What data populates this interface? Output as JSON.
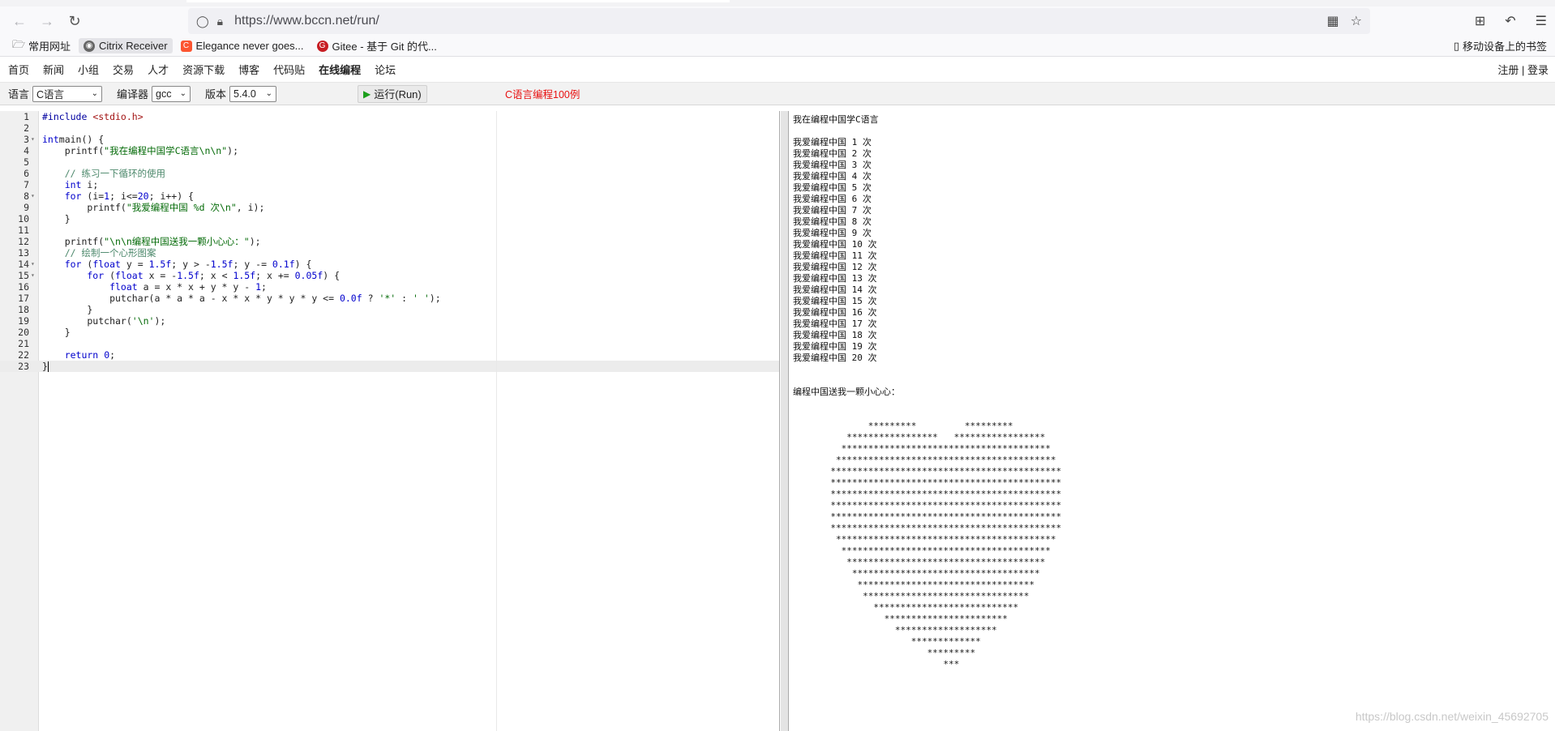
{
  "browser": {
    "url": "https://www.bccn.net/run/",
    "bookmarks": [
      {
        "label": "常用网址",
        "icon": "folder-icon"
      },
      {
        "label": "Citrix Receiver",
        "icon": "citrix-icon"
      },
      {
        "label": "Elegance never goes...",
        "icon": "csdn-icon"
      },
      {
        "label": "Gitee - 基于 Git 的代...",
        "icon": "gitee-icon"
      }
    ],
    "mobile_bookmarks": "移动设备上的书签"
  },
  "site_nav": {
    "items": [
      "首页",
      "新闻",
      "小组",
      "交易",
      "人才",
      "资源下载",
      "博客",
      "代码贴",
      "在线编程",
      "论坛"
    ],
    "current": "在线编程",
    "register": "注册",
    "separator": "|",
    "login": "登录"
  },
  "run_bar": {
    "language_label": "语言",
    "language_value": "C语言",
    "compiler_label": "编译器",
    "compiler_value": "gcc",
    "version_label": "版本",
    "version_value": "5.4.0",
    "run_label": "运行(Run)",
    "promo": "C语言编程100例"
  },
  "editor": {
    "active_line": 23,
    "fold_lines": [
      3,
      8,
      14,
      15
    ],
    "lines": [
      [
        [
          "pp",
          "#include "
        ],
        [
          "inc",
          "<stdio.h>"
        ]
      ],
      [],
      [
        [
          "kw",
          "int"
        ],
        [
          "",
          "main() {"
        ]
      ],
      [
        [
          "",
          "    printf("
        ],
        [
          "str",
          "\"我在编程中国学C语言\\n\\n\""
        ],
        [
          "",
          ");"
        ]
      ],
      [],
      [
        [
          "cmt",
          "    // 练习一下循环的使用"
        ]
      ],
      [
        [
          "kw",
          "    int"
        ],
        [
          "",
          " i;"
        ]
      ],
      [
        [
          "kw",
          "    for"
        ],
        [
          "",
          " (i="
        ],
        [
          "num",
          "1"
        ],
        [
          "",
          "; i<="
        ],
        [
          "num",
          "20"
        ],
        [
          "",
          "; i++) {"
        ]
      ],
      [
        [
          "",
          "        printf("
        ],
        [
          "str",
          "\"我爱编程中国 %d 次\\n\""
        ],
        [
          "",
          ", i);"
        ]
      ],
      [
        [
          "",
          "    }"
        ]
      ],
      [],
      [
        [
          "",
          "    printf("
        ],
        [
          "str",
          "\"\\n\\n编程中国送我一颗小心心：\""
        ],
        [
          "",
          ");"
        ]
      ],
      [
        [
          "cmt",
          "    // 绘制一个心形图案"
        ]
      ],
      [
        [
          "kw",
          "    for"
        ],
        [
          "",
          " ("
        ],
        [
          "kw",
          "float"
        ],
        [
          "",
          " y = "
        ],
        [
          "num",
          "1.5f"
        ],
        [
          "",
          "; y > -"
        ],
        [
          "num",
          "1.5f"
        ],
        [
          "",
          "; y -= "
        ],
        [
          "num",
          "0.1f"
        ],
        [
          "",
          ") {"
        ]
      ],
      [
        [
          "kw",
          "        for"
        ],
        [
          "",
          " ("
        ],
        [
          "kw",
          "float"
        ],
        [
          "",
          " x = -"
        ],
        [
          "num",
          "1.5f"
        ],
        [
          "",
          "; x < "
        ],
        [
          "num",
          "1.5f"
        ],
        [
          "",
          "; x += "
        ],
        [
          "num",
          "0.05f"
        ],
        [
          "",
          ") {"
        ]
      ],
      [
        [
          "kw",
          "            float"
        ],
        [
          "",
          " a = x * x + y * y - "
        ],
        [
          "num",
          "1"
        ],
        [
          "",
          ";"
        ]
      ],
      [
        [
          "",
          "            putchar(a * a * a - x * x * y * y * y <= "
        ],
        [
          "num",
          "0.0f"
        ],
        [
          "",
          " ? "
        ],
        [
          "str",
          "'*'"
        ],
        [
          "",
          " : "
        ],
        [
          "str",
          "' '"
        ],
        [
          "",
          ");"
        ]
      ],
      [
        [
          "",
          "        }"
        ]
      ],
      [
        [
          "",
          "        putchar("
        ],
        [
          "str",
          "'\\n'"
        ],
        [
          "",
          ");"
        ]
      ],
      [
        [
          "",
          "    }"
        ]
      ],
      [],
      [
        [
          "kw",
          "    return"
        ],
        [
          "",
          " "
        ],
        [
          "num",
          "0"
        ],
        [
          "",
          ";"
        ]
      ],
      [
        [
          "",
          "}"
        ]
      ]
    ]
  },
  "output": {
    "text": "我在编程中国学C语言\n\n我爱编程中国 1 次\n我爱编程中国 2 次\n我爱编程中国 3 次\n我爱编程中国 4 次\n我爱编程中国 5 次\n我爱编程中国 6 次\n我爱编程中国 7 次\n我爱编程中国 8 次\n我爱编程中国 9 次\n我爱编程中国 10 次\n我爱编程中国 11 次\n我爱编程中国 12 次\n我爱编程中国 13 次\n我爱编程中国 14 次\n我爱编程中国 15 次\n我爱编程中国 16 次\n我爱编程中国 17 次\n我爱编程中国 18 次\n我爱编程中国 19 次\n我爱编程中国 20 次\n\n\n编程中国送我一颗小心心：\n\n\n              *********         *********\n          *****************   *****************\n         ***************************************\n        *****************************************\n       *******************************************\n       *******************************************\n       *******************************************\n       *******************************************\n       *******************************************\n       *******************************************\n        *****************************************\n         ***************************************\n          *************************************\n           ***********************************\n            *********************************\n             *******************************\n               ***************************\n                 ***********************\n                   *******************\n                      *************\n                         *********\n                            ***",
    "watermark": "https://blog.csdn.net/weixin_45692705"
  }
}
